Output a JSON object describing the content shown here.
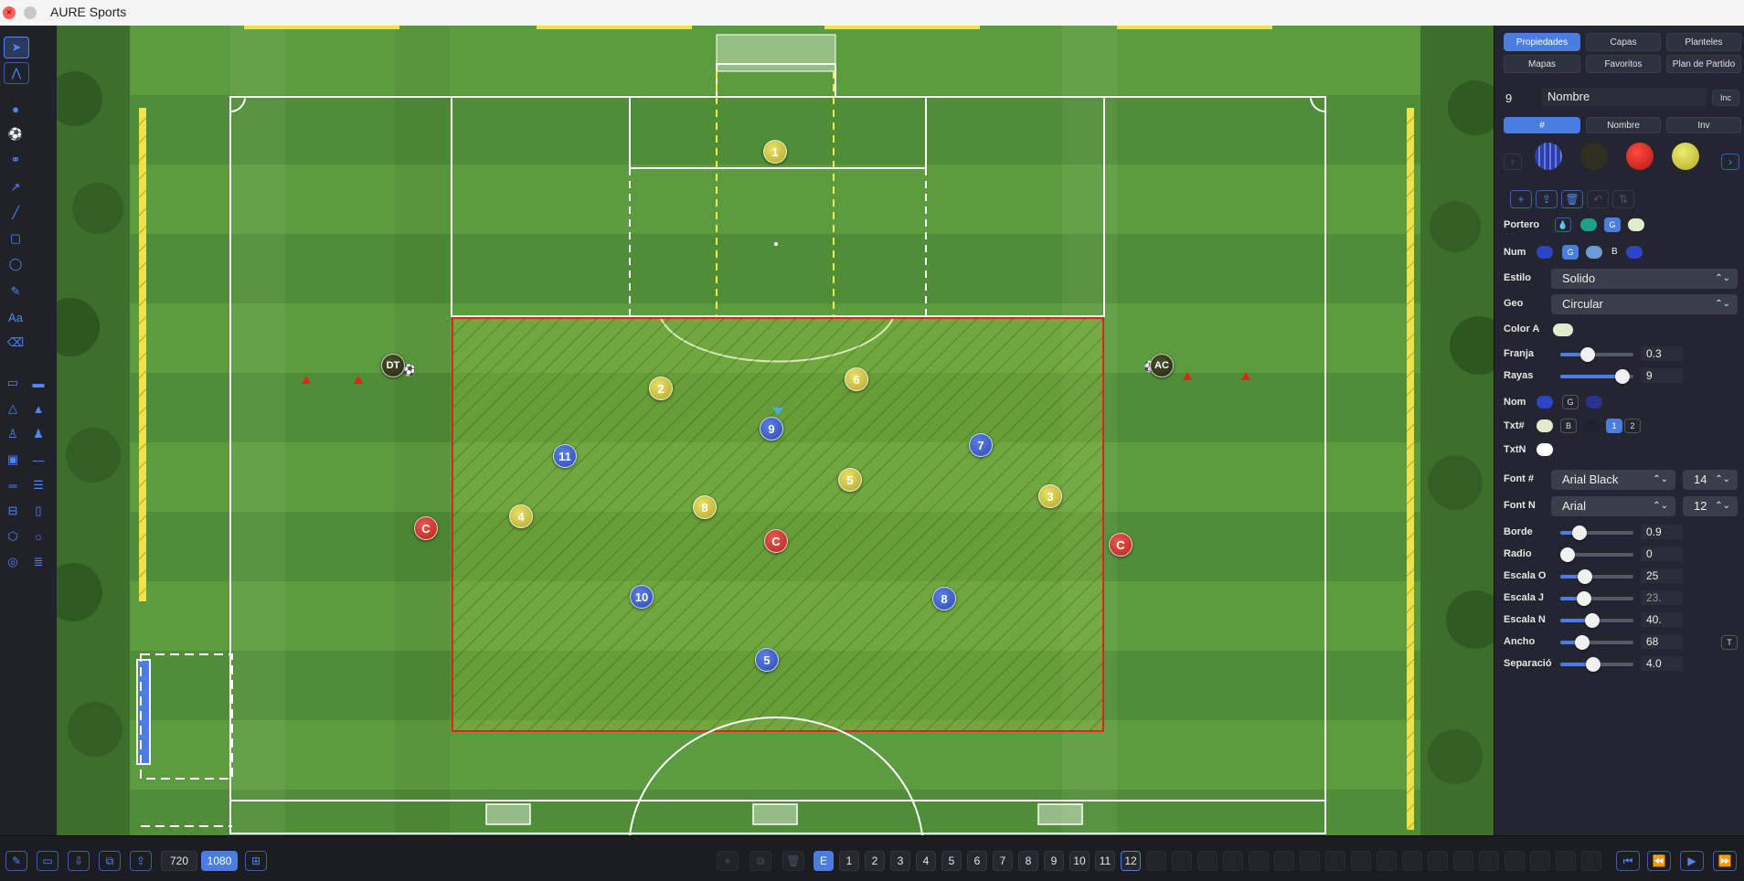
{
  "window": {
    "title": "AURE Sports"
  },
  "icons": {
    "close": "close-icon",
    "minimize": "minimize-icon"
  },
  "field": {
    "players": [
      {
        "label": "1",
        "team": "yellow"
      },
      {
        "label": "2",
        "team": "yellow"
      },
      {
        "label": "6",
        "team": "yellow"
      },
      {
        "label": "4",
        "team": "yellow"
      },
      {
        "label": "8",
        "team": "yellow"
      },
      {
        "label": "5",
        "team": "yellow"
      },
      {
        "label": "3",
        "team": "yellow"
      },
      {
        "label": "9",
        "team": "blue"
      },
      {
        "label": "11",
        "team": "blue"
      },
      {
        "label": "7",
        "team": "blue"
      },
      {
        "label": "10",
        "team": "blue"
      },
      {
        "label": "8",
        "team": "blue"
      },
      {
        "label": "5",
        "team": "blue"
      },
      {
        "label": "C",
        "team": "red"
      },
      {
        "label": "C",
        "team": "red"
      },
      {
        "label": "C",
        "team": "red"
      },
      {
        "label": "DT",
        "team": "dark"
      },
      {
        "label": "AC",
        "team": "dark"
      }
    ]
  },
  "right_panel": {
    "tabs": [
      "Propiedades",
      "Capas",
      "Planteles",
      "Mapas",
      "Favoritos",
      "Plan de Partido"
    ],
    "player_number": "9",
    "player_name": "Nombre",
    "inc_label": "Inc",
    "segments": [
      "#",
      "Nombre",
      "Inv"
    ],
    "portero_label": "Portero",
    "num_label": "Num",
    "estilo_label": "Estilo",
    "estilo_value": "Solido",
    "geo_label": "Geo",
    "geo_value": "Circular",
    "color_a_label": "Color A",
    "franja_label": "Franja",
    "franja_value": "0.3",
    "rayas_label": "Rayas",
    "rayas_value": "9",
    "nom_label": "Nom",
    "txt_hash_label": "Txt#",
    "txtn_label": "TxtN",
    "font_hash_label": "Font #",
    "font_hash_value": "Arial Black",
    "font_hash_size": "14",
    "font_n_label": "Font N",
    "font_n_value": "Arial",
    "font_n_size": "12",
    "chip_g": "G",
    "chip_b": "B",
    "chip_1": "1",
    "chip_2": "2",
    "sliders": [
      {
        "label": "Borde",
        "value": "0.9",
        "level": 0.2
      },
      {
        "label": "Radio",
        "value": "0",
        "level": 0.0
      },
      {
        "label": "Escala O",
        "value": "25",
        "level": 0.3
      },
      {
        "label": "Escala J",
        "value": "23.",
        "level": 0.28
      },
      {
        "label": "Escala N",
        "value": "40.",
        "level": 0.42
      },
      {
        "label": "Ancho",
        "value": "68",
        "level": 0.25
      },
      {
        "label": "Separació",
        "value": "4.0",
        "level": 0.44
      }
    ],
    "t_label": "T"
  },
  "bottom_bar": {
    "res_720": "720",
    "res_1080": "1080",
    "frames": [
      "E",
      "1",
      "2",
      "3",
      "4",
      "5",
      "6",
      "7",
      "8",
      "9",
      "10",
      "11",
      "12"
    ]
  },
  "colors": {
    "accent": "#4a7de0",
    "field_green": "#5a9a3f",
    "zone_red": "#e0231b"
  }
}
